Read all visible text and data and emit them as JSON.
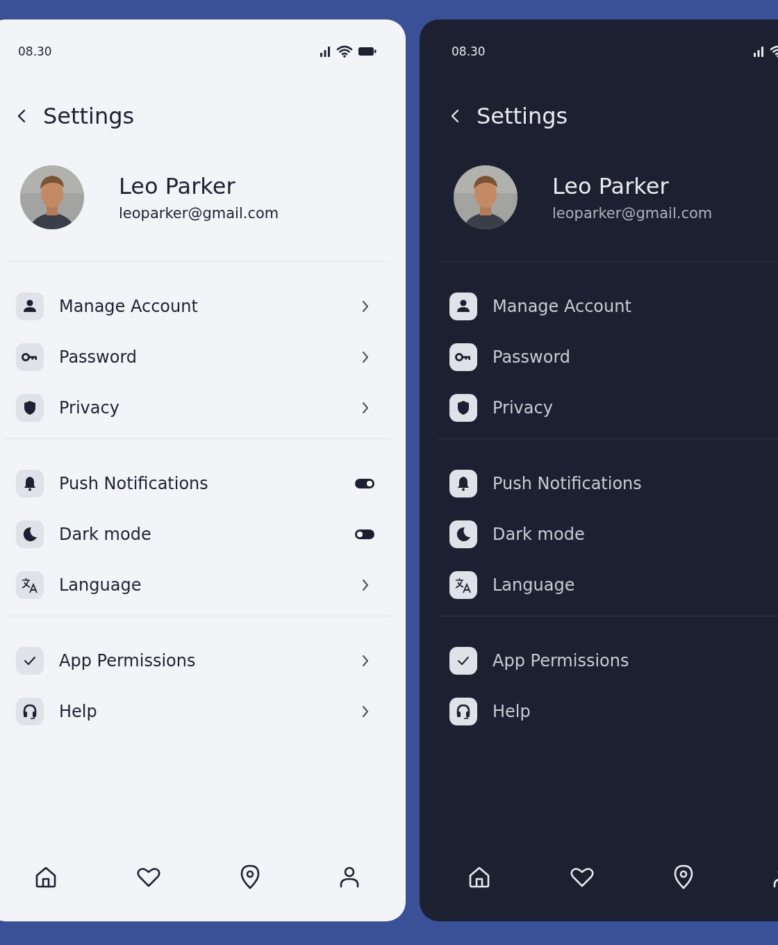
{
  "screens": [
    {
      "kind": "light",
      "status_bar": {
        "time": "08.30"
      },
      "title": "Settings",
      "profile": {
        "name": "Leo Parker",
        "email": "leoparker@gmail.com"
      },
      "sections": [
        {
          "items": [
            {
              "label": "Manage Account",
              "kind": "link"
            },
            {
              "label": "Password",
              "kind": "link"
            },
            {
              "label": "Privacy",
              "kind": "link"
            }
          ]
        },
        {
          "items": [
            {
              "label": "Push Notifications",
              "kind": "toggle",
              "on": true
            },
            {
              "label": "Dark mode",
              "kind": "toggle",
              "on": false
            },
            {
              "label": "Language",
              "kind": "link"
            }
          ]
        },
        {
          "items": [
            {
              "label": "App Permissions",
              "kind": "link"
            },
            {
              "label": "Help",
              "kind": "link"
            }
          ]
        }
      ]
    },
    {
      "kind": "dark",
      "status_bar": {
        "time": "08.30"
      },
      "title": "Settings",
      "profile": {
        "name": "Leo Parker",
        "email": "leoparker@gmail.com"
      },
      "sections": [
        {
          "items": [
            {
              "label": "Manage Account"
            },
            {
              "label": "Password"
            },
            {
              "label": "Privacy"
            }
          ]
        },
        {
          "items": [
            {
              "label": "Push Notifications"
            },
            {
              "label": "Dark mode"
            },
            {
              "label": "Language"
            }
          ]
        },
        {
          "items": [
            {
              "label": "App Permissions"
            },
            {
              "label": "Help"
            }
          ]
        }
      ]
    }
  ]
}
